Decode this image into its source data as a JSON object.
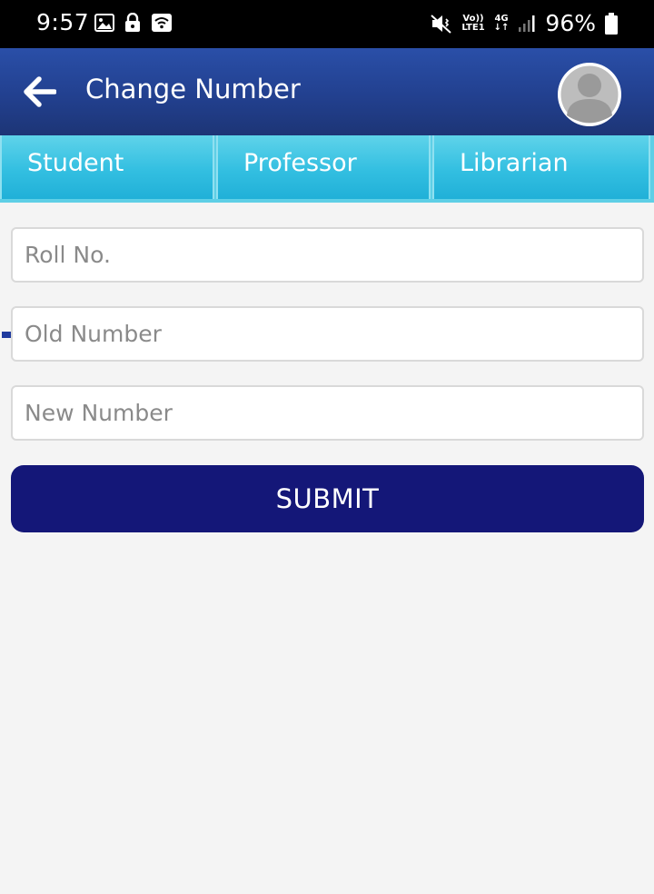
{
  "status_bar": {
    "time": "9:57",
    "left_icons": [
      "image-icon",
      "lock-icon",
      "wifi-icon"
    ],
    "right_icons": [
      "mute-vibrate-icon",
      "volte-icon",
      "4g-icon",
      "signal-icon",
      "battery-icon"
    ],
    "volte_top": "Vo))",
    "volte_bottom": "LTE1",
    "network_top": "4G",
    "network_bottom": "↓↑",
    "battery_text": "96%"
  },
  "app_bar": {
    "title": "Change Number",
    "back_icon": "arrow-left-icon",
    "avatar_icon": "user-avatar-icon",
    "color": "#22408f"
  },
  "tabs": [
    {
      "label": "Student",
      "selected": true
    },
    {
      "label": "Professor",
      "selected": false
    },
    {
      "label": "Librarian",
      "selected": false
    }
  ],
  "form": {
    "roll_no": {
      "placeholder": "Roll No.",
      "value": ""
    },
    "old_number": {
      "placeholder": "Old Number",
      "value": ""
    },
    "new_number": {
      "placeholder": "New Number",
      "value": ""
    },
    "submit_label": "SUBMIT"
  },
  "colors": {
    "accent": "#141778",
    "tab_color": "#33bfe1",
    "tab_indicator": "#1f3a9e",
    "background": "#f4f4f4"
  }
}
